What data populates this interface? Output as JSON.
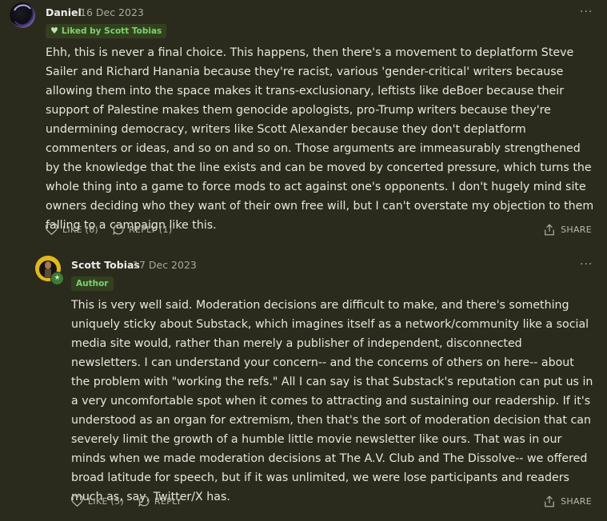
{
  "comments": [
    {
      "author": "Daniel",
      "date": "16 Dec 2023",
      "badge": "Liked by Scott Tobias",
      "body": "Ehh, this is never a final choice. This happens, then there's a movement to deplatform Steve Sailer and Richard Hanania because they're racist, various 'gender-critical' writers because allowing them into the space makes it trans-exclusionary, leftists like deBoer because their support of Palestine makes them genocide apologists, pro-Trump writers because they're undermining democracy, writers like Scott Alexander because they don't deplatform commenters or ideas, and so on and so on. Those arguments are immeasurably strengthened by the knowledge that the line exists and can be moved by concerted pressure, which turns the whole thing into a game to force mods to act against one's opponents. I don't hugely mind site owners deciding who they want of their own free will, but I can't overstate my objection to them falling to a campaign like this.",
      "like_label": "LIKE (6)",
      "reply_label": "REPLY (1)",
      "share_label": "SHARE"
    },
    {
      "author": "Scott Tobias",
      "date": "17 Dec 2023",
      "badge": "Author",
      "body": "This is very well said. Moderation decisions are difficult to make, and there's something uniquely sticky about Substack, which imagines itself as a network/community like a social media site would, rather than merely a publisher of independent, disconnected newsletters. I can understand your concern-- and the concerns of others on here-- about the problem with \"working the refs.\" All I can say is that Substack's reputation can put us in a very uncomfortable spot when it comes to attracting and sustaining our readership. If it's understood as an organ for extremism, then that's the sort of moderation decision that can severely limit the growth of a humble little movie newsletter like ours. That was in our minds when we made moderation decisions at The A.V. Club and The Dissolve-- we offered broad latitude for speech, but if it was unlimited, we were lose participants and readers much as, say, Twitter/X has.",
      "like_label": "LIKE (5)",
      "reply_label": "REPLY",
      "share_label": "SHARE"
    }
  ],
  "colors": {
    "background": "#2b2b1d",
    "badge_text": "#7bd36b",
    "badge_bg": "#33401f",
    "muted": "#a9a99c"
  },
  "icons": [
    "heart-icon",
    "reply-bubble-icon",
    "share-icon",
    "more-dots-icon",
    "star-icon"
  ]
}
